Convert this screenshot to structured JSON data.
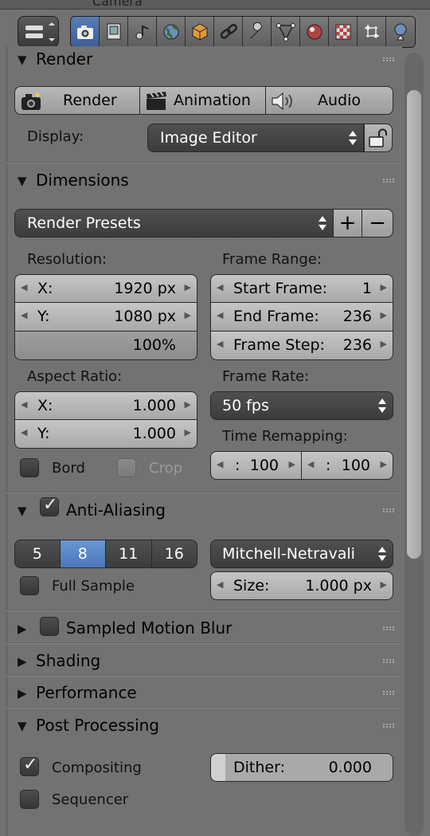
{
  "top_strip": {
    "fragment_text": "Camera"
  },
  "context_tabs": [
    {
      "name": "render-tab",
      "icon": "camera-icon",
      "active": true
    },
    {
      "name": "render-layers-tab",
      "icon": "render-layers-icon",
      "active": false
    },
    {
      "name": "scene-tab",
      "icon": "scene-icon",
      "active": false
    },
    {
      "name": "world-tab",
      "icon": "world-icon",
      "active": false
    },
    {
      "name": "object-tab",
      "icon": "object-cube-icon",
      "active": false
    },
    {
      "name": "constraints-tab",
      "icon": "constraint-link-icon",
      "active": false
    },
    {
      "name": "modifiers-tab",
      "icon": "wrench-icon",
      "active": false
    },
    {
      "name": "object-data-tab",
      "icon": "vertex-data-icon",
      "active": false
    },
    {
      "name": "material-tab",
      "icon": "material-sphere-icon",
      "active": false
    },
    {
      "name": "texture-tab",
      "icon": "checker-texture-icon",
      "active": false
    },
    {
      "name": "particles-tab",
      "icon": "particles-icon",
      "active": false
    },
    {
      "name": "physics-tab",
      "icon": "physics-icon",
      "active": false
    }
  ],
  "render_panel": {
    "title": "Render",
    "render_label": "Render",
    "animation_label": "Animation",
    "audio_label": "Audio",
    "display_label": "Display:",
    "display_value": "Image Editor"
  },
  "dimensions_panel": {
    "title": "Dimensions",
    "presets_value": "Render Presets",
    "resolution_label": "Resolution:",
    "res_x_label": "X:",
    "res_x_value": "1920 px",
    "res_y_label": "Y:",
    "res_y_value": "1080 px",
    "res_percent": "100%",
    "frame_range_label": "Frame Range:",
    "start_label": "Start Frame:",
    "start_value": "1",
    "end_label": "End Frame:",
    "end_value": "236",
    "step_label": "Frame Step:",
    "step_value": "236",
    "aspect_label": "Aspect Ratio:",
    "aspect_x_label": "X:",
    "aspect_x_value": "1.000",
    "aspect_y_label": "Y:",
    "aspect_y_value": "1.000",
    "frame_rate_label": "Frame Rate:",
    "frame_rate_value": "50 fps",
    "time_remap_label": "Time Remapping:",
    "remap_old_label": ":",
    "remap_old_value": "100",
    "remap_new_label": ":",
    "remap_new_value": "100",
    "bord_label": "Bord",
    "crop_label": "Crop"
  },
  "anti_aliasing_panel": {
    "title": "Anti-Aliasing",
    "samples": [
      "5",
      "8",
      "11",
      "16"
    ],
    "selected_sample": "8",
    "filter_value": "Mitchell-Netravali",
    "full_sample_label": "Full Sample",
    "size_label": "Size:",
    "size_value": "1.000 px"
  },
  "collapsed_panels": {
    "motion_blur": "Sampled Motion Blur",
    "shading": "Shading",
    "performance": "Performance"
  },
  "post_processing_panel": {
    "title": "Post Processing",
    "compositing_label": "Compositing",
    "sequencer_label": "Sequencer",
    "dither_label": "Dither:",
    "dither_value": "0.000"
  }
}
